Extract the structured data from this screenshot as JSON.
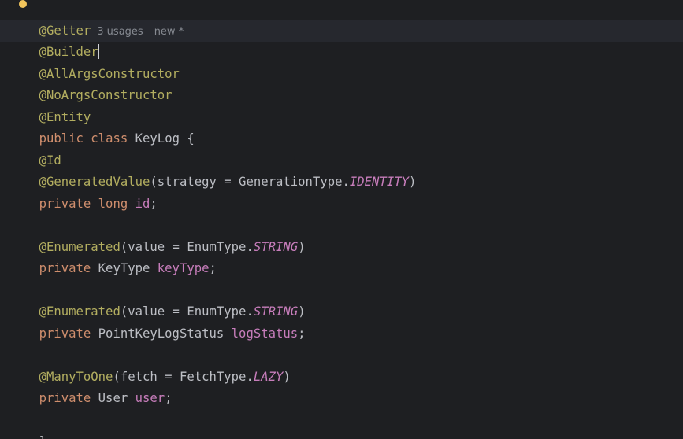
{
  "editor": {
    "inlay_hints": {
      "usages": "3 usages",
      "status": "new *"
    },
    "colors": {
      "background": "#1e1f22",
      "current_line": "#26282e",
      "annotation": "#b3ae60",
      "keyword": "#cf8e6d",
      "field": "#c77dbb",
      "text": "#bcbec4"
    },
    "code": {
      "ann_getter": "@Getter",
      "ann_builder": "@Builder",
      "ann_allargs": "@AllArgsConstructor",
      "ann_noargs": "@NoArgsConstructor",
      "ann_entity": "@Entity",
      "kw_public": "public",
      "kw_class": "class",
      "class_name": "KeyLog",
      "open_brace": "{",
      "ann_id": "@Id",
      "ann_generated": "@GeneratedValue",
      "generated_args_open": "(strategy = GenerationType.",
      "const_identity": "IDENTITY",
      "close_paren": ")",
      "kw_private": "private",
      "kw_long": "long",
      "field_id": "id",
      "semicolon": ";",
      "ann_enumerated": "@Enumerated",
      "enumerated_args_open": "(value = EnumType.",
      "const_string": "STRING",
      "type_keytype": "KeyType",
      "field_keytype": "keyType",
      "type_status": "PointKeyLogStatus",
      "field_status": "logStatus",
      "ann_manytoone": "@ManyToOne",
      "manytoone_args_open": "(fetch = FetchType.",
      "const_lazy": "LAZY",
      "type_user": "User",
      "field_user": "user",
      "close_brace": "}"
    }
  }
}
